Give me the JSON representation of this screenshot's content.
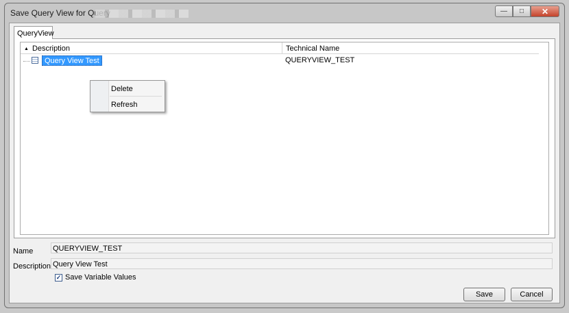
{
  "window": {
    "title": "Save Query View for Query",
    "controls": {
      "minimize_icon": "minimize-icon",
      "maximize_icon": "maximize-icon",
      "close_icon": "close-icon"
    }
  },
  "tabs": [
    {
      "label": "QueryView",
      "active": true
    }
  ],
  "tree": {
    "columns": [
      {
        "label": "Description",
        "sort": "ascending"
      },
      {
        "label": "Technical Name"
      }
    ],
    "rows": [
      {
        "description": "Query View Test",
        "technical_name": "QUERYVIEW_TEST",
        "selected": true
      }
    ]
  },
  "context_menu": {
    "items": [
      {
        "label": "Delete"
      },
      {
        "label": "Refresh"
      }
    ]
  },
  "form": {
    "name_label": "Name",
    "name_value": "QUERYVIEW_TEST",
    "description_label": "Description",
    "description_value": "Query View Test",
    "save_variables_label": "Save Variable Values",
    "save_variables_checked": true
  },
  "buttons": {
    "save": "Save",
    "cancel": "Cancel"
  },
  "colors": {
    "selection": "#3399ff",
    "dialog_bg": "#f0f0f0",
    "close_button": "#c4422a"
  }
}
